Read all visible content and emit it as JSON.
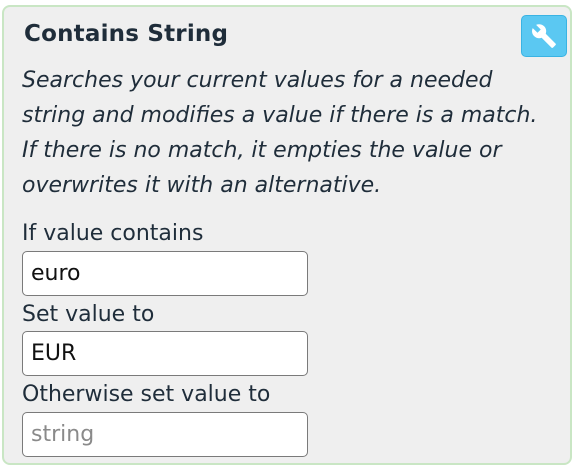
{
  "card": {
    "title": "Contains String",
    "description": "Searches your current values for a needed string and modifies a value if there is a match. If there is no match, it empties the value or overwrites it with an alternative.",
    "settings_icon": "wrench-icon",
    "accent_color": "#5bc8f2",
    "border_color": "#c9e6c4"
  },
  "fields": {
    "contains": {
      "label": "If value contains",
      "value": "euro",
      "placeholder": ""
    },
    "set_value": {
      "label": "Set value to",
      "value": "EUR",
      "placeholder": ""
    },
    "otherwise": {
      "label": "Otherwise set value to",
      "value": "",
      "placeholder": "string"
    }
  }
}
